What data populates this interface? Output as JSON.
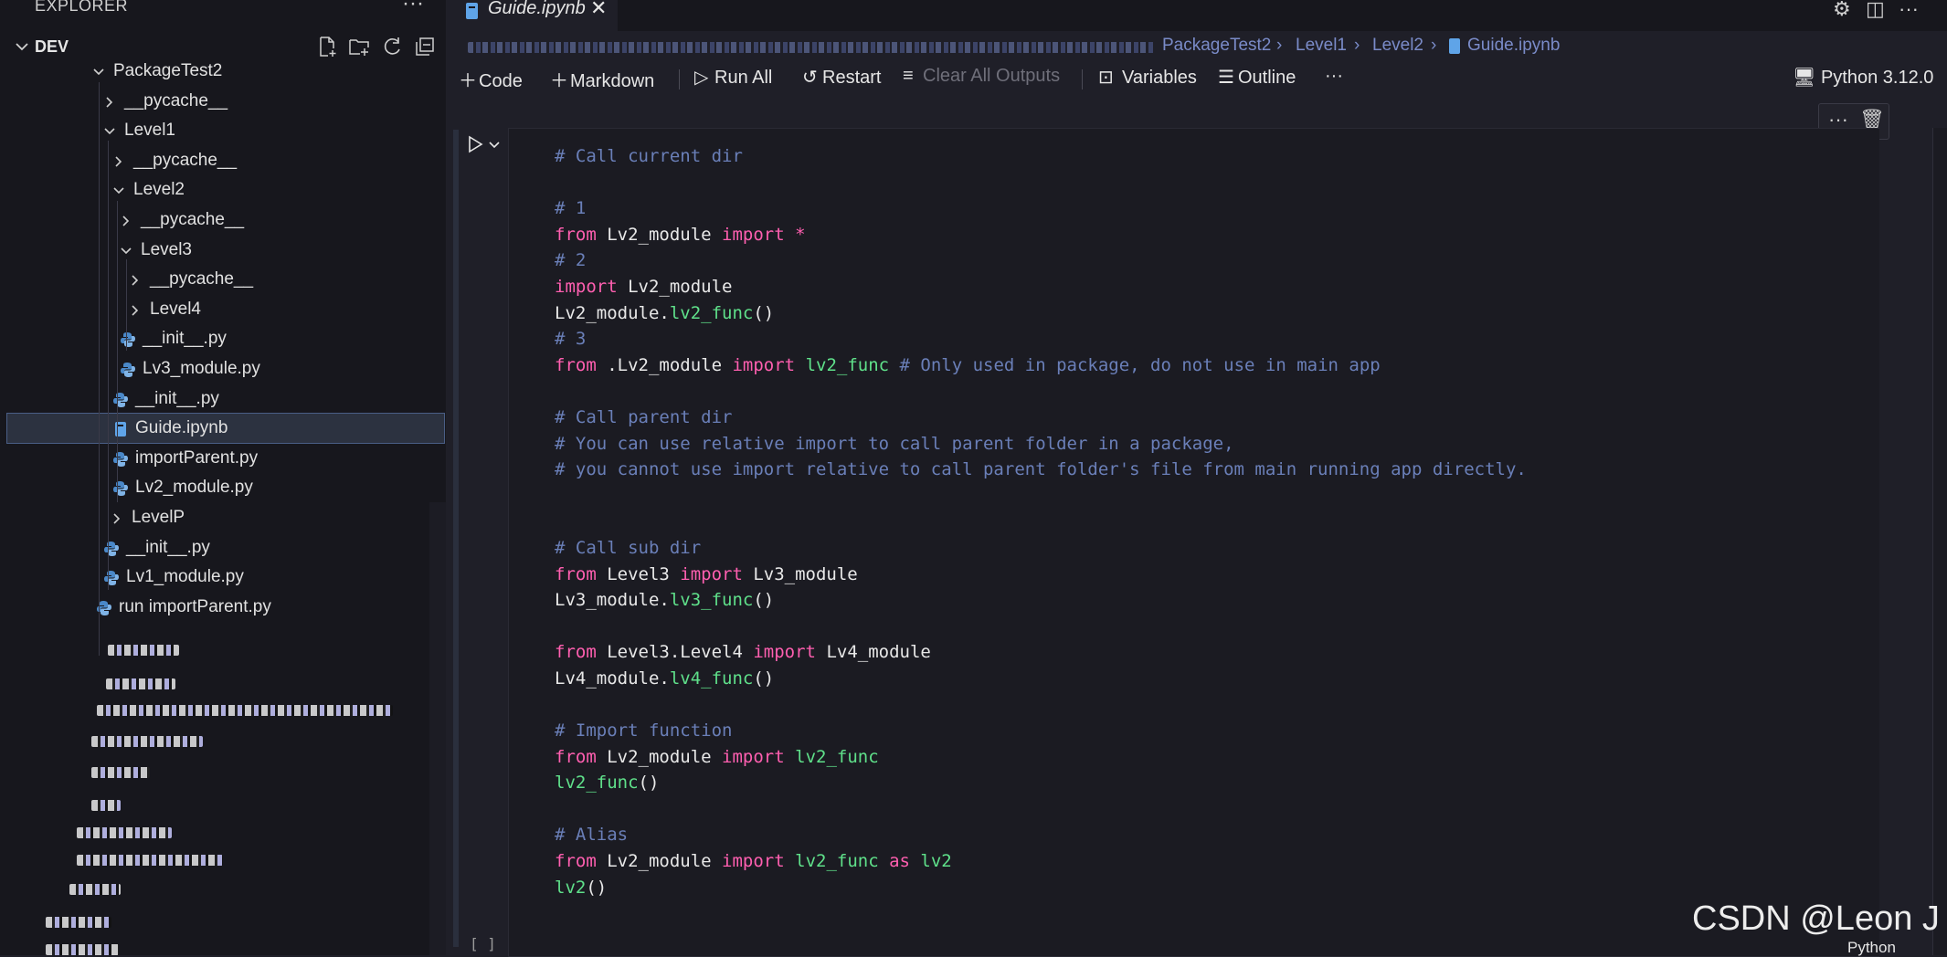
{
  "sidebar": {
    "title": "EXPLORER",
    "section": "DEV",
    "tree": [
      {
        "label": "PackageTest2",
        "type": "folder-open"
      },
      {
        "label": "__pycache__",
        "type": "folder"
      },
      {
        "label": "Level1",
        "type": "folder-open"
      },
      {
        "label": "__pycache__",
        "type": "folder"
      },
      {
        "label": "Level2",
        "type": "folder-open"
      },
      {
        "label": "__pycache__",
        "type": "folder"
      },
      {
        "label": "Level3",
        "type": "folder-open"
      },
      {
        "label": "__pycache__",
        "type": "folder"
      },
      {
        "label": "Level4",
        "type": "folder"
      },
      {
        "label": "__init__.py",
        "type": "python-file"
      },
      {
        "label": "Lv3_module.py",
        "type": "python-file"
      },
      {
        "label": "__init__.py",
        "type": "python-file"
      },
      {
        "label": "Guide.ipynb",
        "type": "notebook-file",
        "selected": true
      },
      {
        "label": "importParent.py",
        "type": "python-file"
      },
      {
        "label": "Lv2_module.py",
        "type": "python-file"
      },
      {
        "label": "LevelP",
        "type": "folder"
      },
      {
        "label": "__init__.py",
        "type": "python-file"
      },
      {
        "label": "Lv1_module.py",
        "type": "python-file"
      },
      {
        "label": "run importParent.py",
        "type": "python-file"
      }
    ]
  },
  "editor": {
    "tab_label": "Guide.ipynb",
    "breadcrumb": [
      "PackageTest2",
      "Level1",
      "Level2",
      "Guide.ipynb"
    ],
    "toolbar": {
      "code": "Code",
      "markdown": "Markdown",
      "run_all": "Run All",
      "restart": "Restart",
      "clear_all_outputs": "Clear All Outputs",
      "variables": "Variables",
      "outline": "Outline",
      "more": "···",
      "kernel": "Python 3.12.0"
    },
    "cell": {
      "execution_count": "[ ]",
      "code_lines": [
        [
          [
            "c",
            "# Call current dir"
          ]
        ],
        [],
        [
          [
            "c",
            "# 1"
          ]
        ],
        [
          [
            "k",
            "from"
          ],
          [
            "p",
            " Lv2_module "
          ],
          [
            "k",
            "import"
          ],
          [
            "k",
            " *"
          ]
        ],
        [
          [
            "c",
            "# 2"
          ]
        ],
        [
          [
            "k",
            "import"
          ],
          [
            "p",
            " Lv2_module"
          ]
        ],
        [
          [
            "p",
            "Lv2_module."
          ],
          [
            "f",
            "lv2_func"
          ],
          [
            "p",
            "()"
          ]
        ],
        [
          [
            "c",
            "# 3"
          ]
        ],
        [
          [
            "k",
            "from"
          ],
          [
            "p",
            " .Lv2_module "
          ],
          [
            "k",
            "import"
          ],
          [
            "f",
            " lv2_func"
          ],
          [
            "c",
            " # Only used in package, do not use in main app"
          ]
        ],
        [],
        [
          [
            "c",
            "# Call parent dir"
          ]
        ],
        [
          [
            "c",
            "# You can use relative import to call parent folder in a package,"
          ]
        ],
        [
          [
            "c",
            "# you cannot use import relative to call parent folder's file from main running app directly."
          ]
        ],
        [],
        [],
        [
          [
            "c",
            "# Call sub dir"
          ]
        ],
        [
          [
            "k",
            "from"
          ],
          [
            "p",
            " Level3 "
          ],
          [
            "k",
            "import"
          ],
          [
            "p",
            " Lv3_module"
          ]
        ],
        [
          [
            "p",
            "Lv3_module."
          ],
          [
            "f",
            "lv3_func"
          ],
          [
            "p",
            "()"
          ]
        ],
        [],
        [
          [
            "k",
            "from"
          ],
          [
            "p",
            " Level3.Level4 "
          ],
          [
            "k",
            "import"
          ],
          [
            "p",
            " Lv4_module"
          ]
        ],
        [
          [
            "p",
            "Lv4_module."
          ],
          [
            "f",
            "lv4_func"
          ],
          [
            "p",
            "()"
          ]
        ],
        [],
        [
          [
            "c",
            "# Import function"
          ]
        ],
        [
          [
            "k",
            "from"
          ],
          [
            "p",
            " Lv2_module "
          ],
          [
            "k",
            "import"
          ],
          [
            "f",
            " lv2_func"
          ]
        ],
        [
          [
            "f",
            "lv2_func"
          ],
          [
            "p",
            "()"
          ]
        ],
        [],
        [
          [
            "c",
            "# Alias"
          ]
        ],
        [
          [
            "k",
            "from"
          ],
          [
            "p",
            " Lv2_module "
          ],
          [
            "k",
            "import"
          ],
          [
            "f",
            " lv2_func"
          ],
          [
            "k",
            " as"
          ],
          [
            "f",
            " lv2"
          ]
        ],
        [
          [
            "f",
            "lv2"
          ],
          [
            "p",
            "()"
          ]
        ]
      ]
    }
  },
  "watermark": "CSDN @Leon J",
  "status": {
    "language": "Python"
  },
  "colors": {
    "keyword": "#ff5fb0",
    "function": "#5fe08a",
    "comment": "#6a7fb8",
    "selection": "#2c3240"
  }
}
